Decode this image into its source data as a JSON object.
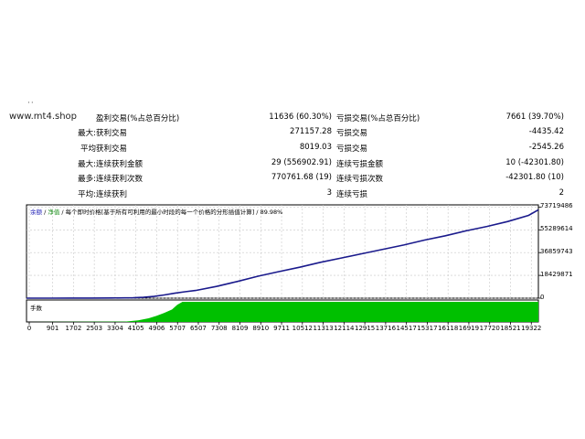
{
  "watermark": "www.mt4.shop",
  "top_dots": "··",
  "stats": [
    {
      "label1": "",
      "name1": "盈利交易(%占总百分比)",
      "value1": "11636 (60.30%)",
      "name2": "亏损交易(%占总百分比)",
      "value2": "7661 (39.70%)"
    },
    {
      "label1": "最大:",
      "name1": "获利交易",
      "value1": "271157.28",
      "name2": "亏损交易",
      "value2": "-4435.42"
    },
    {
      "label1": "平均",
      "name1": "获利交易",
      "value1": "8019.03",
      "name2": "亏损交易",
      "value2": "-2545.26"
    },
    {
      "label1": "最大:",
      "name1": "连续获利金额",
      "value1": "29 (556902.91)",
      "name2": "连续亏损金额",
      "value2": "10 (-42301.80)"
    },
    {
      "label1": "最多:",
      "name1": "连续获利次数",
      "value1": "770761.68 (19)",
      "name2": "连续亏损次数",
      "value2": "-42301.80 (10)"
    },
    {
      "label1": "平均:",
      "name1": "连续获利",
      "value1": "3",
      "name2": "连续亏损",
      "value2": "2"
    }
  ],
  "legend": {
    "balance": "余额",
    "sep1": " / ",
    "equity": "净值",
    "sep2": " / ",
    "description": "每个即时价格[基于所有可利用的最小时段的每一个价格的分形插值计算]",
    "sep3": " / ",
    "quality": "89.98%"
  },
  "colors": {
    "balance_line": "#1a1a8c",
    "volume_fill": "#00c000",
    "grid": "#c8c8c8"
  },
  "chart_data": {
    "type": "line",
    "xlabel": "",
    "ylabel": "",
    "x_ticks": [
      "0",
      "901",
      "1702",
      "2503",
      "3304",
      "4105",
      "4906",
      "5707",
      "6507",
      "7308",
      "8109",
      "8910",
      "9711",
      "10512",
      "11313",
      "12114",
      "12915",
      "13716",
      "14517",
      "15317",
      "16118",
      "16919",
      "17720",
      "18521",
      "19322"
    ],
    "y_ticks": [
      "73719486",
      "55289614",
      "36859743",
      "18429871",
      "0"
    ],
    "xlim": [
      0,
      19700
    ],
    "ylim": [
      0,
      75500000
    ],
    "series": [
      {
        "x": [
          0,
          901,
          1702,
          2503,
          3304,
          4105,
          4500,
          4906,
          5300,
          5707,
          6100,
          6507,
          7308,
          8109,
          8910,
          9711,
          10512,
          11313,
          12114,
          12915,
          13716,
          14517,
          15317,
          16118,
          16919,
          17720,
          18521,
          19322,
          19700
        ],
        "y": [
          0,
          0,
          50000,
          100000,
          150000,
          300000,
          700000,
          1400000,
          2600000,
          4000000,
          5200000,
          6200000,
          9500000,
          13500000,
          17800000,
          21500000,
          25000000,
          29000000,
          32500000,
          36000000,
          39500000,
          43000000,
          47000000,
          50500000,
          54500000,
          58000000,
          62000000,
          67000000,
          71500000
        ]
      }
    ],
    "volume_panel": {
      "label": "手数",
      "x": [
        0,
        3800,
        4300,
        4700,
        5000,
        5300,
        5600,
        5800,
        6000,
        6507,
        19700
      ],
      "level": [
        0,
        0.02,
        0.08,
        0.18,
        0.3,
        0.45,
        0.62,
        0.85,
        1,
        1,
        1
      ]
    }
  }
}
